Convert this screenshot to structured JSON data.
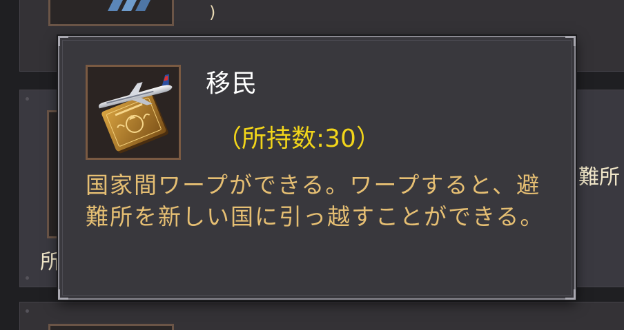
{
  "background": {
    "top_row_paren": ")",
    "right_fragment": "難所",
    "left_fragment": "所"
  },
  "tooltip": {
    "item_icon": "passport-airplane-icon",
    "item_name": "移民",
    "item_count": "（所持数:30）",
    "description": "国家間ワープができる。ワープすると、避難所を新しい国に引っ越すことができる。"
  },
  "colors": {
    "tooltip_bg": "#39383d",
    "name": "#ffffff",
    "count": "#f2d51a",
    "description": "#e6bf73",
    "icon_frame": "#7a5a42"
  }
}
